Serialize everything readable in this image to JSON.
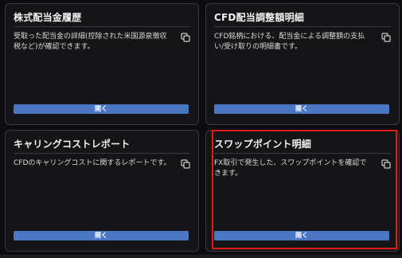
{
  "cards": [
    {
      "title": "株式配当金履歴",
      "description": "受取った配当金の詳細(控除された米国源泉徴収税など)が確認できます。",
      "button_label": "開く",
      "icon": "copy-icon"
    },
    {
      "title": "CFD配当調整額明細",
      "description": "CFD銘柄における、配当金による調整額の支払い/受け取りの明細書です。",
      "button_label": "開く",
      "icon": "copy-icon"
    },
    {
      "title": "キャリングコストレポート",
      "description": "CFDのキャリングコストに関するレポートです。",
      "button_label": "開く",
      "icon": "copy-icon"
    },
    {
      "title": "スワップポイント明細",
      "description": "FX取引で発生した、スワップポイントを確認できます。",
      "button_label": "開く",
      "icon": "copy-icon"
    }
  ],
  "colors": {
    "background": "#0d0d0f",
    "card": "#151517",
    "button": "#4a76c4",
    "highlight": "#e01b1b"
  }
}
